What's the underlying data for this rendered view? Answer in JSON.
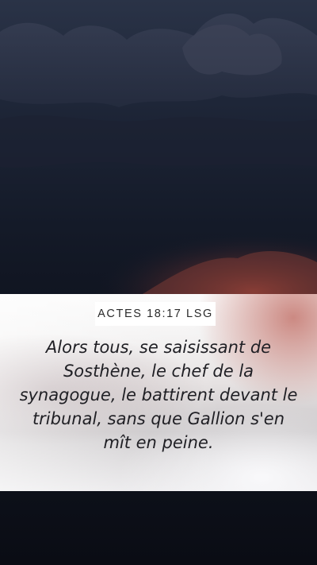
{
  "verse": {
    "reference": "ACTES 18:17 LSG",
    "text": "Alors tous, se saisissant de Sosthène, le chef de la synagogue, le battirent devant le tribunal, sans que Gallion s'en mît en peine."
  },
  "colors": {
    "sky_top": "#2a3347",
    "sky_bottom": "#0a0d16",
    "horizon_glow": "#b0483a",
    "panel_highlight": "#c4766e",
    "verse_text": "#1f1f24",
    "badge_background": "#ffffff"
  }
}
